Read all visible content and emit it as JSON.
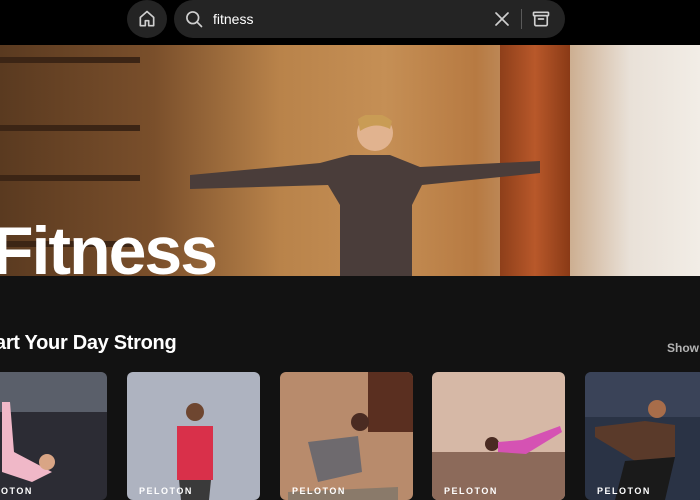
{
  "search": {
    "value": "fitness"
  },
  "hero": {
    "title": "Fitness"
  },
  "section": {
    "title": "art Your Day Strong",
    "show_all": "Show a"
  },
  "cards": [
    {
      "brand": "LOTON",
      "bg": "#2c2c34"
    },
    {
      "brand": "PELOTON",
      "bg": "#aeb3c0"
    },
    {
      "brand": "PELOTON",
      "bg": "#b88b6c"
    },
    {
      "brand": "PELOTON",
      "bg": "#d6b8a6"
    },
    {
      "brand": "PELOTON",
      "bg": "#2a3345"
    }
  ],
  "colors": {
    "background": "#121212",
    "topbar": "#000000",
    "pill": "#242424"
  },
  "icons": [
    "home-icon",
    "search-icon",
    "close-icon",
    "browse-icon"
  ]
}
